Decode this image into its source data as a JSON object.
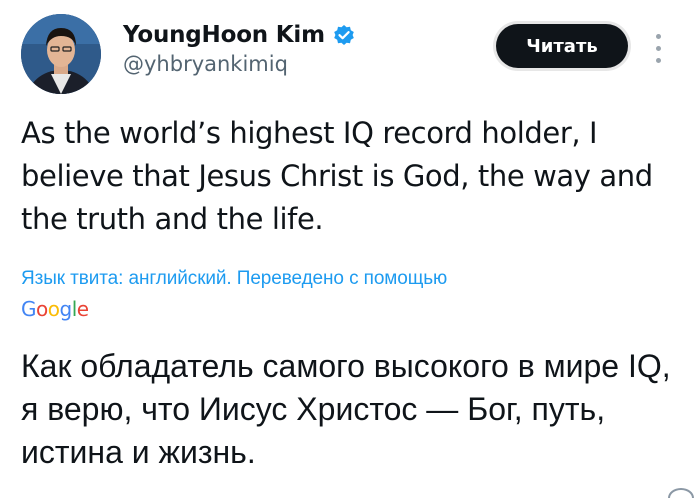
{
  "author": {
    "display_name": "YoungHoon Kim",
    "handle": "@yhbryankimiq",
    "verified": true
  },
  "actions": {
    "read_label": "Читать"
  },
  "tweet": {
    "text": "As the world’s highest IQ record holder, I believe that Jesus Christ is God, the way and the truth and the life."
  },
  "translation": {
    "note": "Язык твита: английский. Переведено с помощью",
    "provider": [
      "G",
      "o",
      "o",
      "g",
      "l",
      "e"
    ],
    "text": "Как обладатель самого высокого в мире IQ, я верю, что Иисус Христос — Бог, путь, истина и жизнь."
  },
  "colors": {
    "accent": "#1d9bf0",
    "text": "#0f1419",
    "secondary": "#536471",
    "button_bg": "#0f1419"
  },
  "icons": {
    "verified": "verified-badge-icon",
    "more": "more-vertical-icon"
  }
}
